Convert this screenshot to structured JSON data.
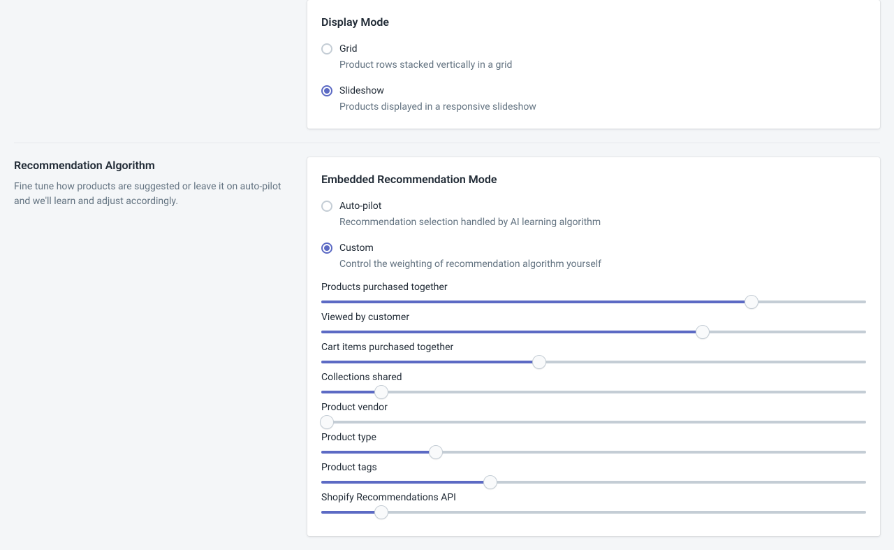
{
  "displayMode": {
    "heading": "Display Mode",
    "options": [
      {
        "label": "Grid",
        "desc": "Product rows stacked vertically in a grid",
        "selected": false
      },
      {
        "label": "Slideshow",
        "desc": "Products displayed in a responsive slideshow",
        "selected": true
      }
    ]
  },
  "recommendation": {
    "title": "Recommendation Algorithm",
    "description": "Fine tune how products are suggested or leave it on auto-pilot and we'll learn and adjust accordingly.",
    "heading": "Embedded Recommendation Mode",
    "modes": [
      {
        "label": "Auto-pilot",
        "desc": "Recommendation selection handled by AI learning algorithm",
        "selected": false
      },
      {
        "label": "Custom",
        "desc": "Control the weighting of recommendation algorithm yourself",
        "selected": true
      }
    ],
    "sliders": [
      {
        "label": "Products purchased together",
        "value": 79
      },
      {
        "label": "Viewed by customer",
        "value": 70
      },
      {
        "label": "Cart items purchased together",
        "value": 40
      },
      {
        "label": "Collections shared",
        "value": 11
      },
      {
        "label": "Product vendor",
        "value": 1
      },
      {
        "label": "Product type",
        "value": 21
      },
      {
        "label": "Product tags",
        "value": 31
      },
      {
        "label": "Shopify Recommendations API",
        "value": 11
      }
    ]
  }
}
